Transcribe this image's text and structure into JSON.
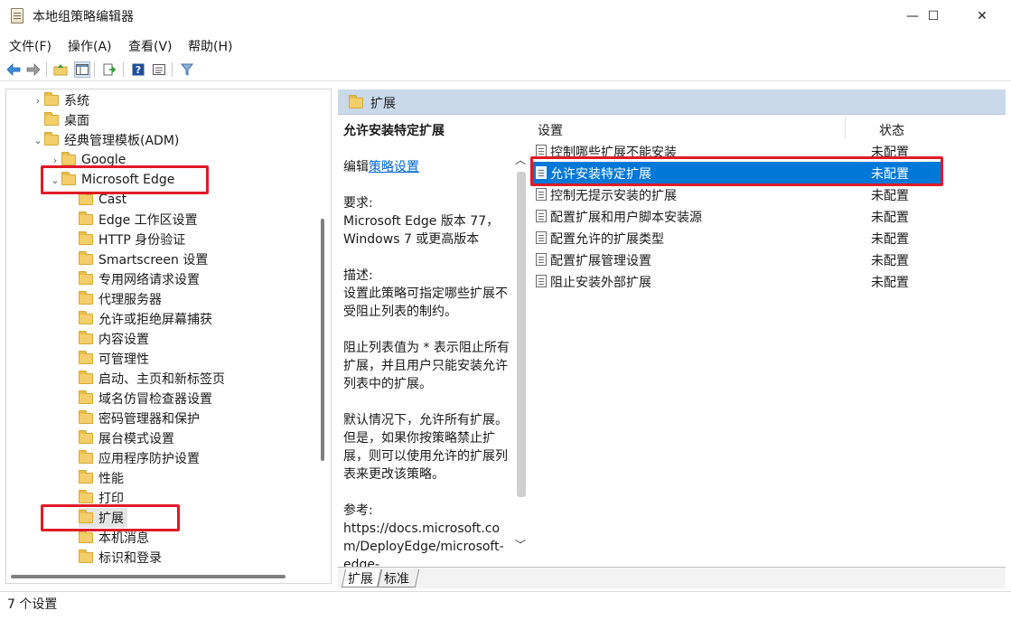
{
  "window": {
    "title": "本地组策略编辑器",
    "controls": {
      "minimize": "—",
      "maximize": "☐",
      "close": "✕"
    }
  },
  "menu": [
    "文件(F)",
    "操作(A)",
    "查看(V)",
    "帮助(H)"
  ],
  "toolbar": {
    "icons": [
      "back-icon",
      "forward-icon",
      "up-folder-icon",
      "show-hide-tree-icon",
      "export-list-icon",
      "help-icon",
      "properties-icon",
      "filter-icon"
    ]
  },
  "tree": {
    "items": [
      {
        "label": "系统",
        "expander": "›"
      },
      {
        "label": "桌面",
        "expander": ""
      },
      {
        "label": "经典管理模板(ADM)",
        "expander": "⌄"
      },
      {
        "label": "Google",
        "expander": "›"
      },
      {
        "label": "Microsoft Edge",
        "expander": "⌄"
      },
      {
        "label": "Cast"
      },
      {
        "label": "Edge 工作区设置"
      },
      {
        "label": "HTTP 身份验证"
      },
      {
        "label": "Smartscreen 设置"
      },
      {
        "label": "专用网络请求设置"
      },
      {
        "label": "代理服务器"
      },
      {
        "label": "允许或拒绝屏幕捕获"
      },
      {
        "label": "内容设置"
      },
      {
        "label": "可管理性"
      },
      {
        "label": "启动、主页和新标签页"
      },
      {
        "label": "域名仿冒检查器设置"
      },
      {
        "label": "密码管理器和保护"
      },
      {
        "label": "展台模式设置"
      },
      {
        "label": "应用程序防护设置"
      },
      {
        "label": "性能"
      },
      {
        "label": "打印"
      },
      {
        "label": "扩展"
      },
      {
        "label": "本机消息"
      },
      {
        "label": "标识和登录"
      }
    ]
  },
  "right": {
    "header": "扩展",
    "description": {
      "title": "允许安装特定扩展",
      "edit_prefix": "编辑",
      "edit_link": "策略设置",
      "requirements_label": "要求:",
      "requirements_text": "Microsoft Edge 版本 77，Windows 7 或更高版本",
      "description_label": "描述:",
      "description_text": "设置此策略可指定哪些扩展不受阻止列表的制约。",
      "para2": "阻止列表值为 * 表示阻止所有扩展，并且用户只能安装允许列表中的扩展。",
      "para3": "默认情况下，允许所有扩展。但是，如果你按策略禁止扩展，则可以使用允许的扩展列表来更改该策略。",
      "ref_label": "参考:",
      "ref_text": "https://docs.microsoft.com/DeployEdge/microsoft-edge-"
    },
    "columns": {
      "setting": "设置",
      "status": "状态"
    },
    "settings": [
      {
        "name": "控制哪些扩展不能安装",
        "status": "未配置"
      },
      {
        "name": "允许安装特定扩展",
        "status": "未配置"
      },
      {
        "name": "控制无提示安装的扩展",
        "status": "未配置"
      },
      {
        "name": "配置扩展和用户脚本安装源",
        "status": "未配置"
      },
      {
        "name": "配置允许的扩展类型",
        "status": "未配置"
      },
      {
        "name": "配置扩展管理设置",
        "status": "未配置"
      },
      {
        "name": "阻止安装外部扩展",
        "status": "未配置"
      }
    ],
    "selected_index": 1,
    "tabs": [
      "扩展",
      "标准"
    ]
  },
  "status_bar": "7 个设置",
  "colors": {
    "selection": "#0078d7",
    "highlight_box": "#e01a26",
    "header_bg": "#c9d9ea",
    "link": "#0066cc"
  }
}
